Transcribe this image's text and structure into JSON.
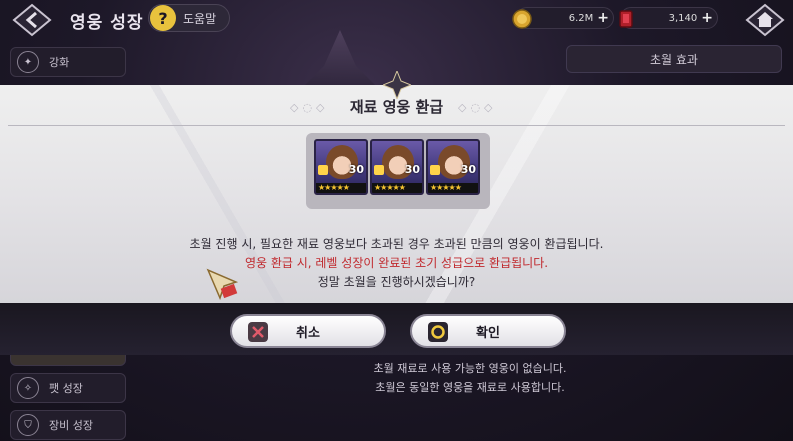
{
  "header": {
    "title": "영웅 성장",
    "help_symbol": "?",
    "help_label": "도움말",
    "gold": "6.2M",
    "gems": "3,140"
  },
  "left_tabs": [
    {
      "label": "강화"
    },
    {
      "label": ""
    },
    {
      "label": "팻 성장"
    },
    {
      "label": "장비 성장"
    }
  ],
  "right_panel": {
    "header": "초월 효과",
    "info_lines": [
      "초월 재료로 사용 가능한 영웅이 없습니다.",
      "초월은 동일한 영웅을 재료로 사용합니다."
    ]
  },
  "modal": {
    "title": "재료 영웅 환급",
    "heroes": [
      {
        "level": "30",
        "stars": "★★★★★"
      },
      {
        "level": "30",
        "stars": "★★★★★"
      },
      {
        "level": "30",
        "stars": "★★★★★"
      }
    ],
    "message_line1": "초월 진행 시, 필요한 재료 영웅보다 초과된 경우 초과된 만큼의 영웅이 환급됩니다.",
    "message_line2": "영웅 환급 시, 레벨 성장이 완료된 초기 성급으로 환급됩니다.",
    "message_line3": "정말 초월을 진행하시겠습니까?"
  },
  "actions": {
    "cancel_label": "취소",
    "confirm_label": "확인"
  },
  "colors": {
    "warning_text": "#c0292e",
    "gold_accent": "#e8c23d"
  }
}
